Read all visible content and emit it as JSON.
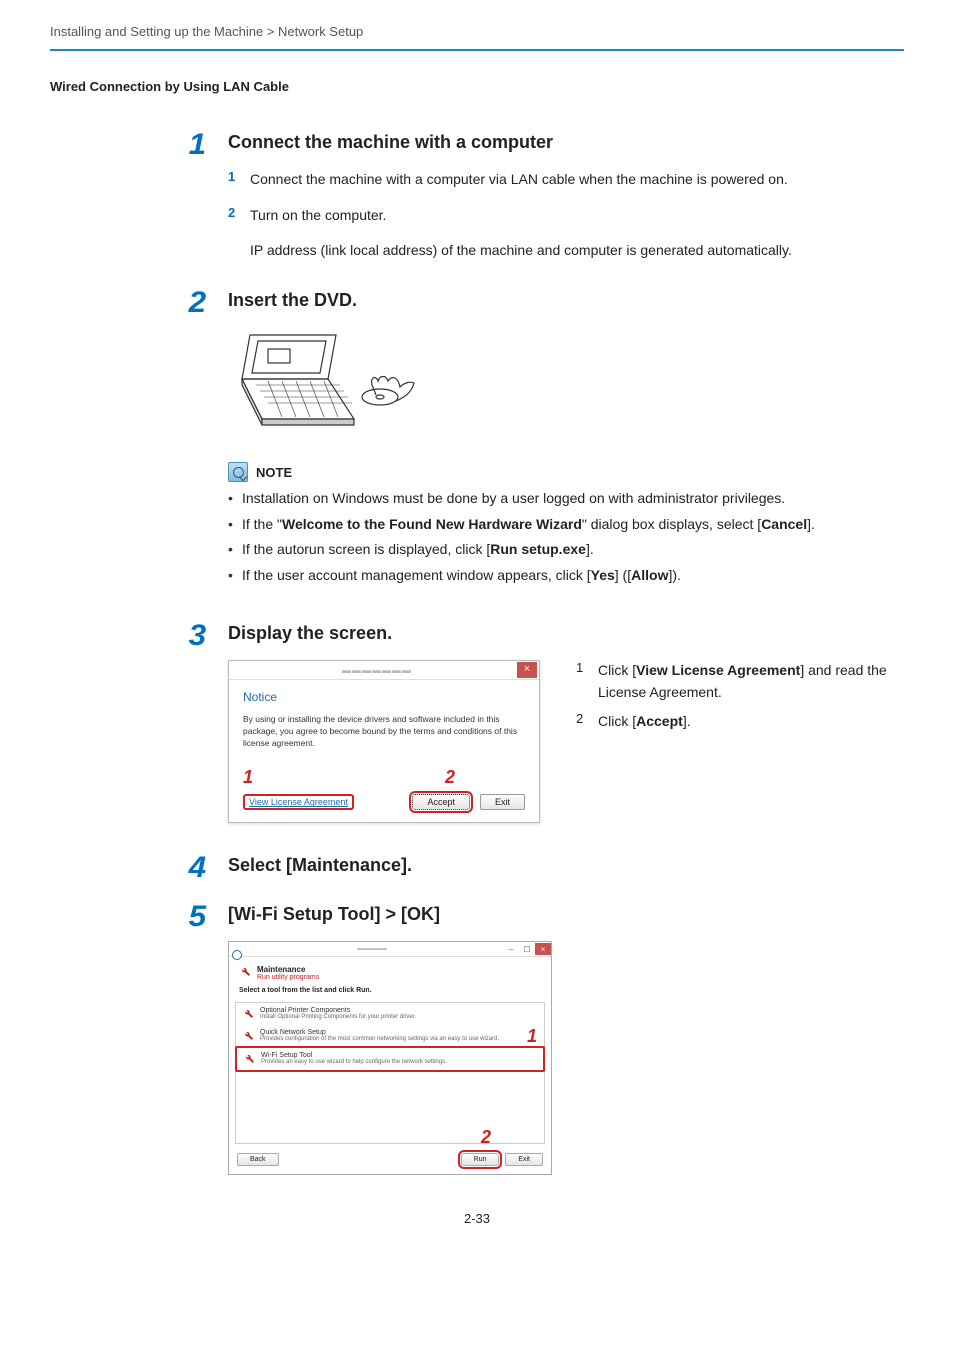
{
  "breadcrumb": "Installing and Setting up the Machine > Network Setup",
  "section_title": "Wired Connection by Using LAN Cable",
  "steps": {
    "s1": {
      "num": "1",
      "heading": "Connect the machine with a computer",
      "items": {
        "i1": {
          "n": "1",
          "t": "Connect the machine with a computer via LAN cable when the machine is powered on."
        },
        "i2": {
          "n": "2",
          "t": "Turn on the computer."
        }
      },
      "note_after": "IP address (link local address) of the machine and computer is generated automatically."
    },
    "s2": {
      "num": "2",
      "heading": "Insert the DVD."
    },
    "note": {
      "label": "NOTE",
      "b1_pre": "Installation on Windows must be done by a user logged on with administrator privileges.",
      "b2_pre": "If the \"",
      "b2_bold1": "Welcome to the Found New Hardware Wizard",
      "b2_mid": "\" dialog box displays, select [",
      "b2_bold2": "Cancel",
      "b2_post": "].",
      "b3_pre": "If the autorun screen is displayed, click [",
      "b3_bold": "Run setup.exe",
      "b3_post": "].",
      "b4_pre": "If the user account management window appears, click [",
      "b4_bold1": "Yes",
      "b4_mid": "] ([",
      "b4_bold2": "Allow",
      "b4_post": "])."
    },
    "s3": {
      "num": "3",
      "heading": "Display the screen.",
      "right": {
        "i1": {
          "n": "1",
          "pre": "Click [",
          "bold": "View License Agreement",
          "post": "] and read the License Agreement."
        },
        "i2": {
          "n": "2",
          "pre": "Click [",
          "bold": "Accept",
          "post": "]."
        }
      },
      "dialog": {
        "title": "Notice",
        "text": "By using or installing the device drivers and software included in this package, you agree to become bound by the terms and conditions of this license agreement.",
        "callout1": "1",
        "callout2": "2",
        "link": "View License Agreement",
        "accept": "Accept",
        "exit": "Exit",
        "close": "×"
      }
    },
    "s4": {
      "num": "4",
      "heading": "Select [Maintenance]."
    },
    "s5": {
      "num": "5",
      "heading": "[Wi-Fi Setup Tool] > [OK]",
      "window": {
        "maint_title": "Maintenance",
        "maint_sub": "Run utility programs",
        "hint": "Select a tool from the list and click Run.",
        "opt1_t": "Optional Printer Components",
        "opt1_d": "Install Optional Printing Components for your printer driver.",
        "opt2_t": "Quick Network Setup",
        "opt2_d": "Provides configuration of the most common networking settings via an easy to use wizard.",
        "opt3_t": "Wi-Fi Setup Tool",
        "opt3_d": "Provides an easy to use wizard to help configure the network settings.",
        "back": "Back",
        "run": "Run",
        "exit": "Exit",
        "callout1": "1",
        "callout2": "2"
      }
    }
  },
  "page_num": "2-33"
}
